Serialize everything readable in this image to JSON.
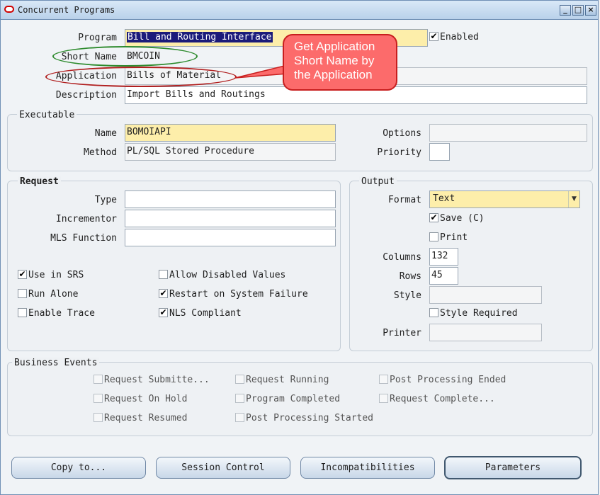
{
  "window": {
    "title": "Concurrent Programs",
    "minimize_glyph": "_",
    "maximize_glyph": "□",
    "close_glyph": "×"
  },
  "header": {
    "program_label": "Program",
    "program_value": "Bill and Routing Interface",
    "enabled_label": "Enabled",
    "enabled_checked": true,
    "short_name_label": "Short Name",
    "short_name_value": "BMCOIN",
    "application_label": "Application",
    "application_value": "Bills of Material",
    "description_label": "Description",
    "description_value": "Import Bills and Routings"
  },
  "annotation": {
    "callout_text": "Get Application Short Name by the Application",
    "short_name_circle_color": "#2e8b2e",
    "application_circle_color": "#b01e1e",
    "callout_color": "#fc6b6b"
  },
  "executable": {
    "title": "Executable",
    "name_label": "Name",
    "name_value": "BOMOIAPI",
    "method_label": "Method",
    "method_value": "PL/SQL Stored Procedure",
    "options_label": "Options",
    "options_value": "",
    "priority_label": "Priority",
    "priority_value": ""
  },
  "request": {
    "title": "Request",
    "type_label": "Type",
    "type_value": "",
    "incrementor_label": "Incrementor",
    "incrementor_value": "",
    "mls_label": "MLS Function",
    "mls_value": "",
    "checkboxes": {
      "use_in_srs": {
        "label": "Use in SRS",
        "checked": true
      },
      "run_alone": {
        "label": "Run Alone",
        "checked": false
      },
      "enable_trace": {
        "label": "Enable Trace",
        "checked": false
      },
      "allow_disabled": {
        "label": "Allow Disabled Values",
        "checked": false
      },
      "restart": {
        "label": "Restart on System Failure",
        "checked": true
      },
      "nls": {
        "label": "NLS Compliant",
        "checked": true
      }
    }
  },
  "output": {
    "title": "Output",
    "format_label": "Format",
    "format_value": "Text",
    "save_label": "Save (C)",
    "save_checked": true,
    "print_label": "Print",
    "print_checked": false,
    "columns_label": "Columns",
    "columns_value": "132",
    "rows_label": "Rows",
    "rows_value": "45",
    "style_label": "Style",
    "style_value": "",
    "style_required_label": "Style Required",
    "style_required_checked": false,
    "printer_label": "Printer",
    "printer_value": ""
  },
  "business_events": {
    "title": "Business Events",
    "items": {
      "submitted": {
        "label": "Request Submitte...",
        "checked": false
      },
      "on_hold": {
        "label": "Request On Hold",
        "checked": false
      },
      "resumed": {
        "label": "Request Resumed",
        "checked": false
      },
      "running": {
        "label": "Request Running",
        "checked": false
      },
      "prog_completed": {
        "label": "Program Completed",
        "checked": false
      },
      "post_started": {
        "label": "Post Processing Started",
        "checked": false
      },
      "post_ended": {
        "label": "Post Processing Ended",
        "checked": false
      },
      "req_completed": {
        "label": "Request Complete...",
        "checked": false
      }
    }
  },
  "buttons": {
    "copy_to": "Copy to...",
    "session_control": "Session Control",
    "incompatibilities": "Incompatibilities",
    "parameters": "Parameters"
  }
}
